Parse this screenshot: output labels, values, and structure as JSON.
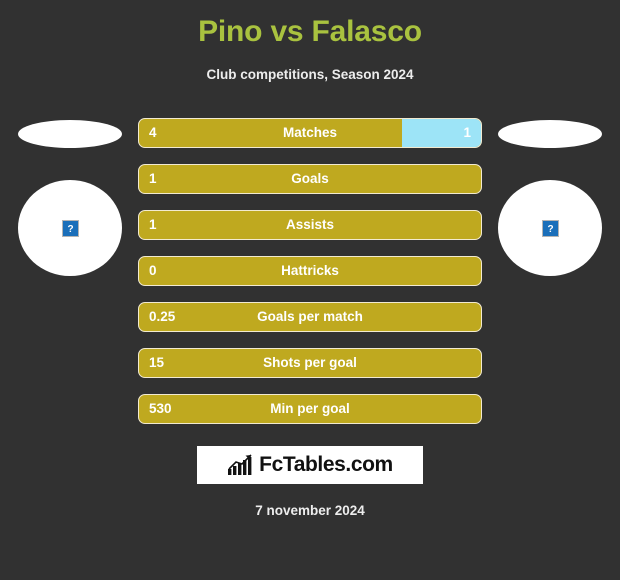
{
  "header": {
    "title": "Pino vs Falasco",
    "subtitle": "Club competitions, Season 2024",
    "title_color": "#a9c23f"
  },
  "home": {
    "club_logo_alt": "club-logo-placeholder",
    "player_photo_alt": "broken-image-placeholder"
  },
  "away": {
    "club_logo_alt": "club-logo-placeholder",
    "player_photo_alt": "broken-image-placeholder"
  },
  "colors": {
    "background": "#313131",
    "bar_home": "#bfa91f",
    "bar_away": "#9de4f7",
    "bar_border": "#f2ead0",
    "text": "#ffffff"
  },
  "chart_data": {
    "type": "bar",
    "title": "Pino vs Falasco",
    "subtitle": "Club competitions, Season 2024",
    "orientation": "horizontal-diverging",
    "categories": [
      "Matches",
      "Goals",
      "Assists",
      "Hattricks",
      "Goals per match",
      "Shots per goal",
      "Min per goal"
    ],
    "series": [
      {
        "name": "Pino",
        "values": [
          4,
          1,
          1,
          0,
          0.25,
          15,
          530
        ]
      },
      {
        "name": "Falasco",
        "values": [
          1,
          null,
          null,
          null,
          null,
          null,
          null
        ]
      }
    ],
    "legend": "none",
    "grid": false
  },
  "stats": [
    {
      "label": "Matches",
      "home": "4",
      "away": "1",
      "home_pct": 77,
      "away_pct": 23
    },
    {
      "label": "Goals",
      "home": "1",
      "away": "",
      "home_pct": 100,
      "away_pct": 0
    },
    {
      "label": "Assists",
      "home": "1",
      "away": "",
      "home_pct": 100,
      "away_pct": 0
    },
    {
      "label": "Hattricks",
      "home": "0",
      "away": "",
      "home_pct": 100,
      "away_pct": 0
    },
    {
      "label": "Goals per match",
      "home": "0.25",
      "away": "",
      "home_pct": 100,
      "away_pct": 0
    },
    {
      "label": "Shots per goal",
      "home": "15",
      "away": "",
      "home_pct": 100,
      "away_pct": 0
    },
    {
      "label": "Min per goal",
      "home": "530",
      "away": "",
      "home_pct": 100,
      "away_pct": 0
    }
  ],
  "footer": {
    "logo_text": "FcTables.com",
    "logo_icon": "bar-chart-trend-icon",
    "date": "7 november 2024"
  }
}
